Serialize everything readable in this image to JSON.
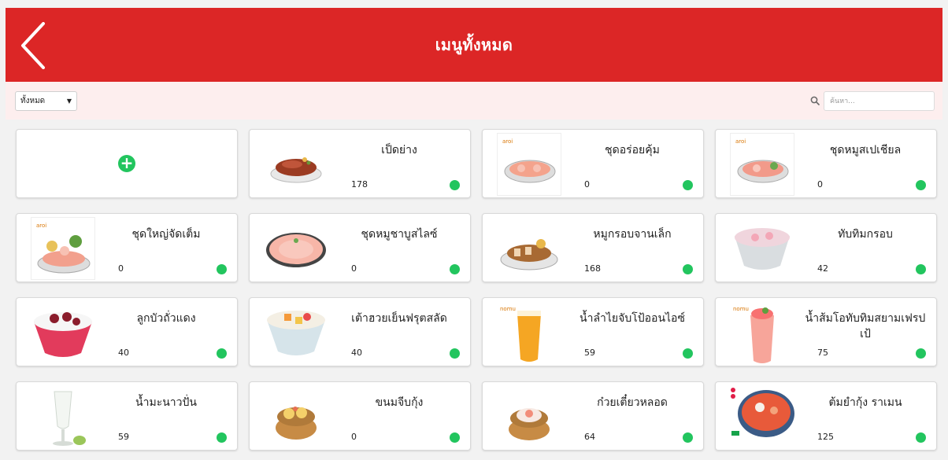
{
  "header": {
    "title": "เมนูทั้งหมด",
    "back_icon": "chevron-left-icon",
    "color": "#dc2626"
  },
  "filter": {
    "category": "ทั้งหมด",
    "search_placeholder": "ค้นหา..."
  },
  "status_color": "#22c55e",
  "menu_items": [
    {
      "name": "เป็ดย่าง",
      "qty": "178",
      "image": "roast-duck"
    },
    {
      "name": "ชุดอร่อยคุ้ม",
      "qty": "0",
      "image": "meat-platter"
    },
    {
      "name": "ชุดหมูสเปเชียล",
      "qty": "0",
      "image": "pork-platter"
    },
    {
      "name": "ชุดใหญ่จัดเต็ม",
      "qty": "0",
      "image": "big-platter"
    },
    {
      "name": "ชุดหมูชาบูสไลซ์",
      "qty": "0",
      "image": "sliced-pork"
    },
    {
      "name": "หมูกรอบจานเล็ก",
      "qty": "168",
      "image": "crispy-pork"
    },
    {
      "name": "ทับทิมกรอบ",
      "qty": "42",
      "image": "tubtim-krob"
    },
    {
      "name": "ลูกบัวถั่วแดง",
      "qty": "40",
      "image": "red-bean-dessert"
    },
    {
      "name": "เต้าฮวยเย็นฟรุตสลัด",
      "qty": "40",
      "image": "fruit-tofu"
    },
    {
      "name": "น้ำลำไยจับโป้ออนไอซ์",
      "qty": "59",
      "image": "longan-drink"
    },
    {
      "name": "น้ำส้มโอทับทิมสยามเฟรปเป้",
      "qty": "75",
      "image": "pomelo-frappe"
    },
    {
      "name": "น้ำมะนาวปั่น",
      "qty": "59",
      "image": "lime-smoothie"
    },
    {
      "name": "ขนมจีบกุ้ง",
      "qty": "0",
      "image": "shrimp-dumpling"
    },
    {
      "name": "ก๋วยเตี๋ยวหลอด",
      "qty": "64",
      "image": "rice-roll"
    },
    {
      "name": "ต้มยำกุ้ง ราเมน",
      "qty": "125",
      "image": "tomyum-ramen"
    }
  ]
}
